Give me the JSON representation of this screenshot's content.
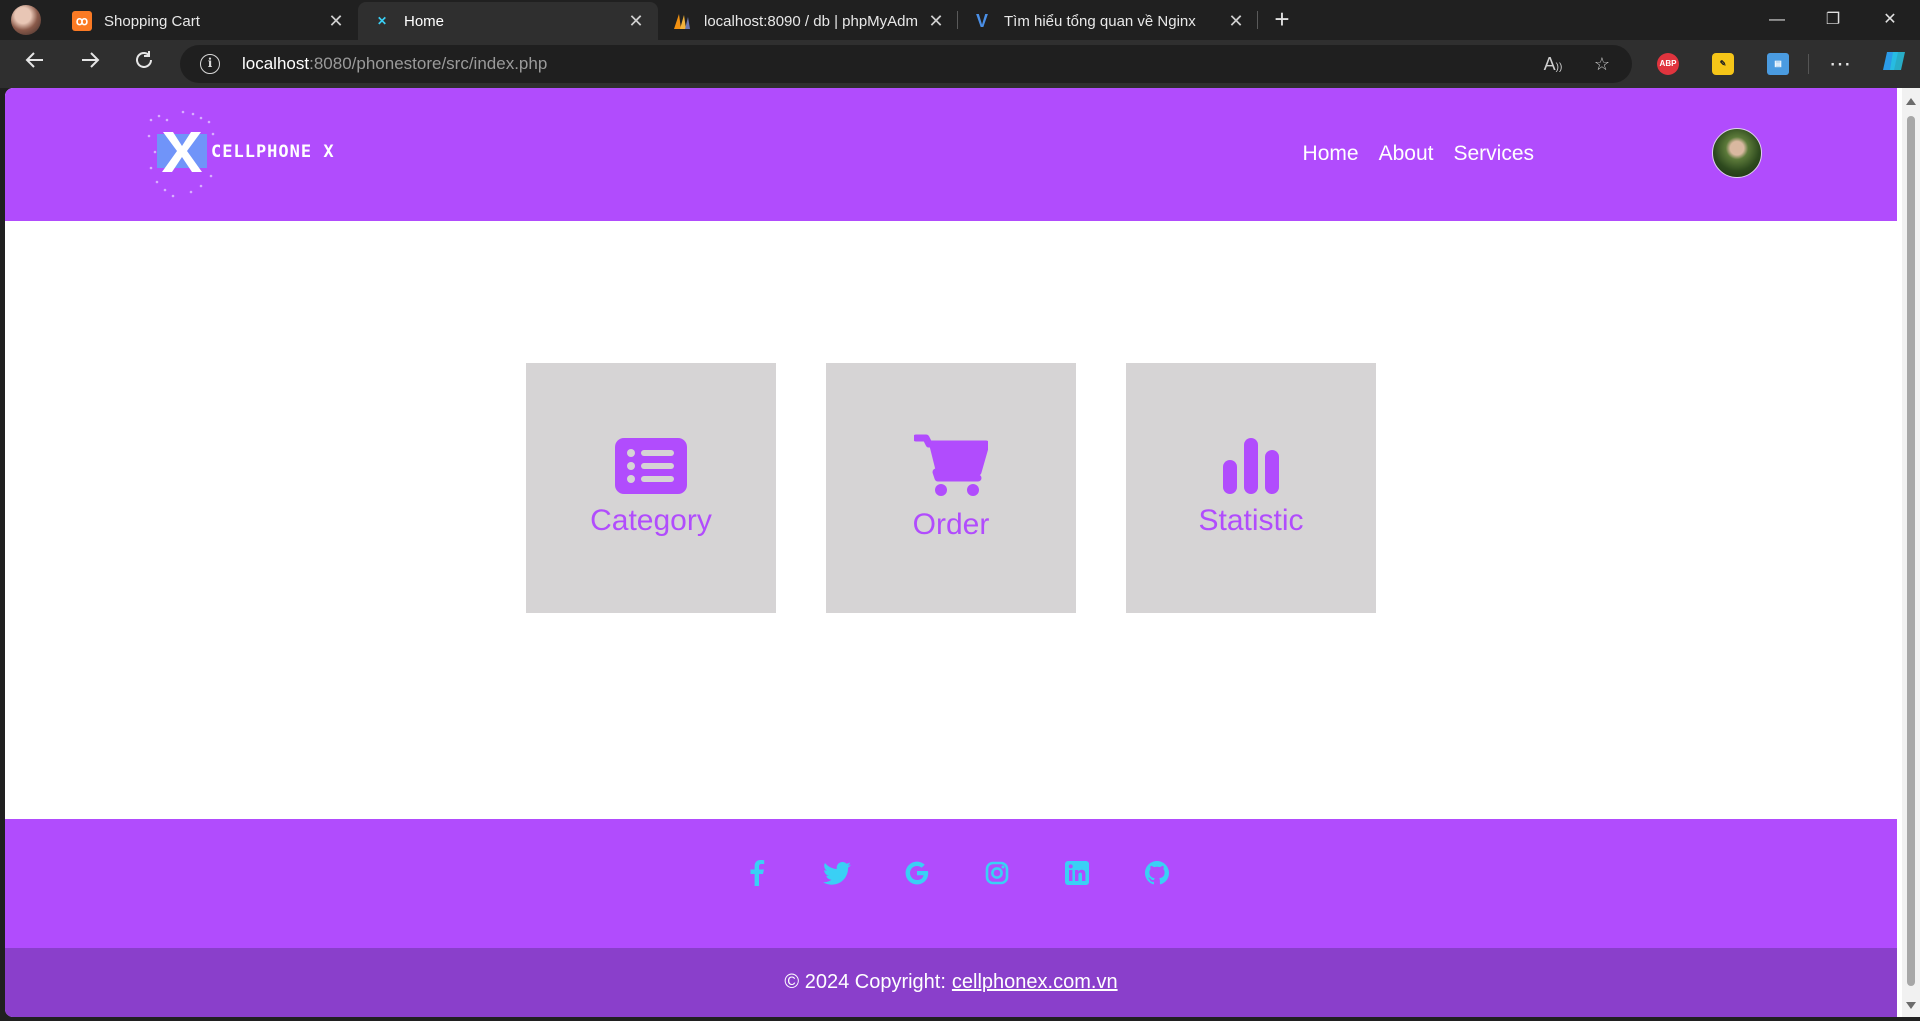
{
  "browser": {
    "tabs": [
      {
        "title": "Shopping Cart",
        "favicon": "xampp-icon",
        "active": false
      },
      {
        "title": "Home",
        "favicon": "cellphonex-icon",
        "active": true
      },
      {
        "title": "localhost:8090 / db | phpMyAdm",
        "favicon": "phpmyadmin-icon",
        "active": false
      },
      {
        "title": "Tìm hiểu tổng quan về Nginx",
        "favicon": "v-icon",
        "active": false
      }
    ],
    "url_host": "localhost",
    "url_rest": ":8080/phonestore/src/index.php",
    "extensions": [
      "ABP"
    ]
  },
  "site": {
    "logo_text": "CELLPHONE X",
    "nav": [
      "Home",
      "About",
      "Services"
    ],
    "cards": [
      {
        "label": "Category",
        "icon": "list-icon"
      },
      {
        "label": "Order",
        "icon": "cart-icon"
      },
      {
        "label": "Statistic",
        "icon": "bar-chart-icon"
      }
    ],
    "socials": [
      "facebook-icon",
      "twitter-icon",
      "google-icon",
      "instagram-icon",
      "linkedin-icon",
      "github-icon"
    ],
    "copyright_prefix": "© 2024 Copyright:",
    "copyright_link": "cellphonex.com.vn"
  },
  "colors": {
    "brand": "#b14cfd",
    "brand_dark": "#8a3fcb",
    "card_bg": "#d6d4d5",
    "social": "#3ad0f5"
  }
}
